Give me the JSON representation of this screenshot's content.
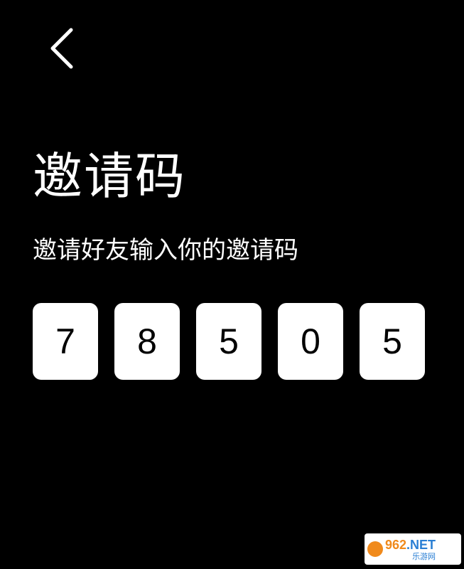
{
  "header": {
    "back_icon": "chevron-left-icon"
  },
  "page": {
    "title": "邀请码",
    "subtitle": "邀请好友输入你的邀请码"
  },
  "invite_code": {
    "digits": [
      "7",
      "8",
      "5",
      "0",
      "5"
    ]
  },
  "watermark": {
    "brand_number": "962",
    "brand_suffix": ".NET",
    "brand_sub": "乐游网"
  },
  "colors": {
    "background": "#000000",
    "text": "#ffffff",
    "code_box": "#ffffff",
    "code_digit": "#000000"
  }
}
